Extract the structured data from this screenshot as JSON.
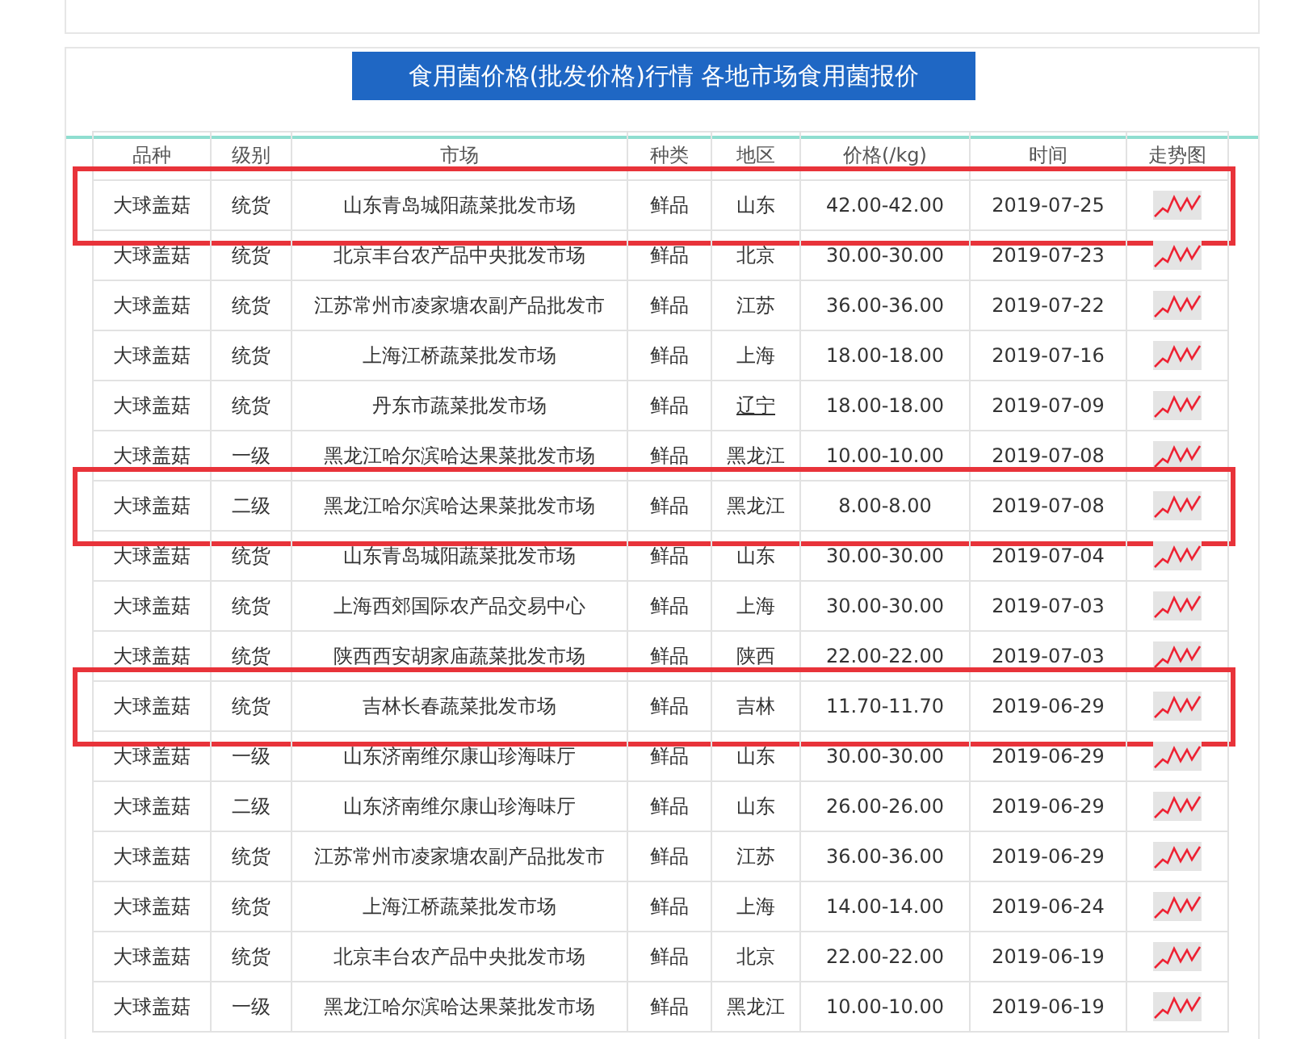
{
  "panel": {
    "title": "食用菌价格(批发价格)行情 各地市场食用菌报价"
  },
  "table": {
    "columns": [
      "品种",
      "级别",
      "市场",
      "种类",
      "地区",
      "价格(/kg)",
      "时间",
      "走势图"
    ],
    "rows": [
      {
        "cells": [
          "大球盖菇",
          "统货",
          "山东青岛城阳蔬菜批发市场",
          "鲜品",
          "山东",
          "42.00-42.00",
          "2019-07-25"
        ],
        "highlighted": true,
        "region_linked": false
      },
      {
        "cells": [
          "大球盖菇",
          "统货",
          "北京丰台农产品中央批发市场",
          "鲜品",
          "北京",
          "30.00-30.00",
          "2019-07-23"
        ],
        "highlighted": false,
        "region_linked": false
      },
      {
        "cells": [
          "大球盖菇",
          "统货",
          "江苏常州市凌家塘农副产品批发市",
          "鲜品",
          "江苏",
          "36.00-36.00",
          "2019-07-22"
        ],
        "highlighted": false,
        "region_linked": false
      },
      {
        "cells": [
          "大球盖菇",
          "统货",
          "上海江桥蔬菜批发市场",
          "鲜品",
          "上海",
          "18.00-18.00",
          "2019-07-16"
        ],
        "highlighted": false,
        "region_linked": false
      },
      {
        "cells": [
          "大球盖菇",
          "统货",
          "丹东市蔬菜批发市场",
          "鲜品",
          "辽宁",
          "18.00-18.00",
          "2019-07-09"
        ],
        "highlighted": false,
        "region_linked": true
      },
      {
        "cells": [
          "大球盖菇",
          "一级",
          "黑龙江哈尔滨哈达果菜批发市场",
          "鲜品",
          "黑龙江",
          "10.00-10.00",
          "2019-07-08"
        ],
        "highlighted": false,
        "region_linked": false
      },
      {
        "cells": [
          "大球盖菇",
          "二级",
          "黑龙江哈尔滨哈达果菜批发市场",
          "鲜品",
          "黑龙江",
          "8.00-8.00",
          "2019-07-08"
        ],
        "highlighted": true,
        "region_linked": false
      },
      {
        "cells": [
          "大球盖菇",
          "统货",
          "山东青岛城阳蔬菜批发市场",
          "鲜品",
          "山东",
          "30.00-30.00",
          "2019-07-04"
        ],
        "highlighted": false,
        "region_linked": false
      },
      {
        "cells": [
          "大球盖菇",
          "统货",
          "上海西郊国际农产品交易中心",
          "鲜品",
          "上海",
          "30.00-30.00",
          "2019-07-03"
        ],
        "highlighted": false,
        "region_linked": false
      },
      {
        "cells": [
          "大球盖菇",
          "统货",
          "陕西西安胡家庙蔬菜批发市场",
          "鲜品",
          "陕西",
          "22.00-22.00",
          "2019-07-03"
        ],
        "highlighted": false,
        "region_linked": false
      },
      {
        "cells": [
          "大球盖菇",
          "统货",
          "吉林长春蔬菜批发市场",
          "鲜品",
          "吉林",
          "11.70-11.70",
          "2019-06-29"
        ],
        "highlighted": true,
        "region_linked": false
      },
      {
        "cells": [
          "大球盖菇",
          "一级",
          "山东济南维尔康山珍海味厅",
          "鲜品",
          "山东",
          "30.00-30.00",
          "2019-06-29"
        ],
        "highlighted": false,
        "region_linked": false
      },
      {
        "cells": [
          "大球盖菇",
          "二级",
          "山东济南维尔康山珍海味厅",
          "鲜品",
          "山东",
          "26.00-26.00",
          "2019-06-29"
        ],
        "highlighted": false,
        "region_linked": false
      },
      {
        "cells": [
          "大球盖菇",
          "统货",
          "江苏常州市凌家塘农副产品批发市",
          "鲜品",
          "江苏",
          "36.00-36.00",
          "2019-06-29"
        ],
        "highlighted": false,
        "region_linked": false
      },
      {
        "cells": [
          "大球盖菇",
          "统货",
          "上海江桥蔬菜批发市场",
          "鲜品",
          "上海",
          "14.00-14.00",
          "2019-06-24"
        ],
        "highlighted": false,
        "region_linked": false
      },
      {
        "cells": [
          "大球盖菇",
          "统货",
          "北京丰台农产品中央批发市场",
          "鲜品",
          "北京",
          "22.00-22.00",
          "2019-06-19"
        ],
        "highlighted": false,
        "region_linked": false
      },
      {
        "cells": [
          "大球盖菇",
          "一级",
          "黑龙江哈尔滨哈达果菜批发市场",
          "鲜品",
          "黑龙江",
          "10.00-10.00",
          "2019-06-19"
        ],
        "highlighted": false,
        "region_linked": false
      }
    ]
  }
}
